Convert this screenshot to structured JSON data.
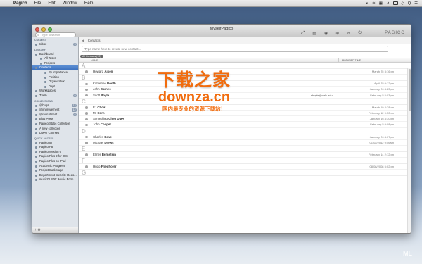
{
  "menubar": {
    "apple": "",
    "items": [
      "Pagico",
      "File",
      "Edit",
      "Window",
      "Help"
    ],
    "status": [
      "◐",
      "≋",
      "▦",
      "⊿",
      "◇",
      "Q",
      "☰"
    ]
  },
  "window": {
    "title": "MyselfPagico",
    "search_placeholder": "Type to search",
    "brand": "PAGICO",
    "toolbar_icons": [
      "⤢",
      "▤",
      "◉",
      "⊕",
      "✂",
      "⏻"
    ]
  },
  "sidebar": {
    "sections": [
      {
        "title": "COLLECT",
        "items": [
          {
            "label": "Inbox",
            "badge": "3",
            "level": 1
          }
        ]
      },
      {
        "title": "LIBRARY",
        "items": [
          {
            "label": "Dashboard",
            "level": 1
          },
          {
            "label": "All Tasks",
            "level": 2
          },
          {
            "label": "Projects",
            "level": 2
          },
          {
            "label": "Contacts",
            "level": 1,
            "selected": true
          },
          {
            "label": "By Importance",
            "level": 2
          },
          {
            "label": "Position",
            "level": 2
          },
          {
            "label": "Organization",
            "level": 2
          },
          {
            "label": "Dept",
            "level": 2
          },
          {
            "label": "Workspaces",
            "level": 1
          },
          {
            "label": "Trash",
            "badge": "0",
            "level": 1
          }
        ]
      },
      {
        "title": "COLLECTIONS",
        "items": [
          {
            "label": "@bugs",
            "badge": "12",
            "level": 1
          },
          {
            "label": "@improvement",
            "badge": "12",
            "level": 1
          },
          {
            "label": "@recruitment",
            "badge": "6",
            "level": 1
          },
          {
            "label": "Blog Posts",
            "level": 1
          },
          {
            "label": "Pagico Static Collection",
            "level": 1
          },
          {
            "label": "A new collection",
            "level": 1
          },
          {
            "label": "DMAT Courses",
            "level": 1
          }
        ]
      },
      {
        "title": "QUICK ACCESS",
        "items": [
          {
            "label": "Pagico ID",
            "level": 1
          },
          {
            "label": "Pagico P8",
            "level": 1
          },
          {
            "label": "Pagico version 6",
            "level": 1
          },
          {
            "label": "Pagico Plus 2 for iOS",
            "level": 1
          },
          {
            "label": "Pagico Plus on iPad",
            "level": 1
          },
          {
            "label": "Academic Progress",
            "level": 1
          },
          {
            "label": "Project Backstage",
            "level": 1
          },
          {
            "label": "Department Website Redo...",
            "level": 1
          },
          {
            "label": "musicGUIDE: Music Form...",
            "level": 1
          }
        ]
      }
    ],
    "bottom": "+  ⚙"
  },
  "main": {
    "crumb_arrow": "◀",
    "crumb": "Contacts",
    "input_placeholder": "Type name here to create new contact...",
    "filter_chip": "All Contacts (13)",
    "col_name": "NAME",
    "col_modified": "MODIFIED TIME",
    "groups": [
      {
        "letter": "A",
        "rows": [
          {
            "first": "Howard",
            "last": "Aiken",
            "email": "",
            "date": "March 25 3:16pm"
          }
        ]
      },
      {
        "letter": "B",
        "rows": [
          {
            "first": "Katherine",
            "last": "Booth",
            "email": "",
            "date": "April 25 9:12pm"
          },
          {
            "first": "John",
            "last": "Barnes",
            "email": "",
            "date": "January 20 4:23pm"
          },
          {
            "first": "Scott",
            "last": "Boyle",
            "email": "sboyle@ctrlc.edu",
            "date": "February 5 5:03pm"
          }
        ]
      },
      {
        "letter": "C",
        "rows": [
          {
            "first": "EJ",
            "last": "Chow",
            "email": "",
            "date": "March 19 4:28pm"
          },
          {
            "first": "Mr",
            "last": "Corn",
            "email": "",
            "date": "February 12 9:50pm"
          },
          {
            "first": "Something",
            "last": "Chen DMA",
            "email": "",
            "date": "January 16 4:30pm"
          },
          {
            "first": "John",
            "last": "Cooper",
            "email": "",
            "date": "February 5 9:08pm"
          }
        ]
      },
      {
        "letter": "D",
        "rows": [
          {
            "first": "Charles",
            "last": "Dave",
            "email": "",
            "date": "January 20 4:07pm"
          },
          {
            "first": "Michael",
            "last": "Drews",
            "email": "",
            "date": "01/02/2012 9:56am"
          }
        ]
      },
      {
        "letter": "E",
        "rows": [
          {
            "first": "Elmer",
            "last": "Bernstein",
            "email": "",
            "date": "February 14 2:12pm"
          }
        ]
      },
      {
        "letter": "F",
        "rows": [
          {
            "first": "Hugo",
            "last": "Friedhofer",
            "email": "",
            "date": "08/08/2008 5:02pm"
          }
        ]
      },
      {
        "letter": "G",
        "rows": []
      }
    ]
  },
  "watermark": {
    "line1": "下载之家",
    "line2": "downza.cn",
    "line3": "国内最专业的资源下载站！"
  },
  "corner_logo": "ML",
  "colors": {
    "selection": "#3a6fbd",
    "watermark": "#f16c0e"
  }
}
